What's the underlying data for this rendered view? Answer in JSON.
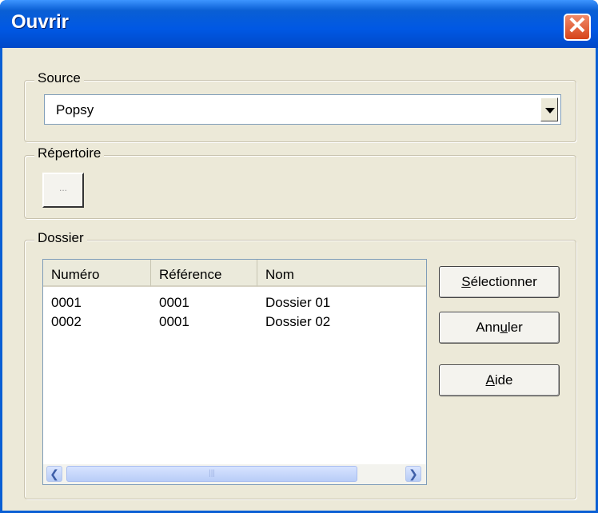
{
  "window": {
    "title": "Ouvrir",
    "close_glyph": "✕"
  },
  "source": {
    "legend": "Source",
    "selected": "Popsy"
  },
  "repertoire": {
    "legend": "Répertoire",
    "browse_label": "..."
  },
  "dossier": {
    "legend": "Dossier",
    "columns": [
      "Numéro",
      "Référence",
      "Nom"
    ],
    "rows": [
      [
        "0001",
        "0001",
        "Dossier 01"
      ],
      [
        "0002",
        "0001",
        "Dossier 02"
      ]
    ]
  },
  "buttons": {
    "select": {
      "mnemonic": "S",
      "rest": "électionner"
    },
    "cancel": {
      "pre": "Ann",
      "mnemonic": "u",
      "rest": "ler"
    },
    "help": {
      "mnemonic": "A",
      "rest": "ide"
    }
  },
  "scrollbar": {
    "left_glyph": "❮",
    "right_glyph": "❯",
    "grip": "|||"
  },
  "colors": {
    "title_bar": "#0a5fd4",
    "dialog_bg": "#ece9d8",
    "close_button": "#d64319"
  }
}
